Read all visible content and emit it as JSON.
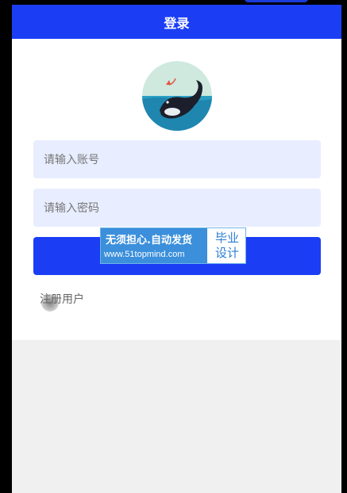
{
  "navbar": {
    "title": "登录"
  },
  "logo": {
    "icon": "whale-logo-icon"
  },
  "form": {
    "username_placeholder": "请输入账号",
    "password_placeholder": "请输入密码",
    "login_label": "",
    "register_label": "注册用户"
  },
  "watermark": {
    "line1": "无须担心.自动发货",
    "line2": "www.51topmind.com",
    "right_line1": "毕业",
    "right_line2": "设计"
  },
  "colors": {
    "primary": "#1b3ef5",
    "input_bg": "#e8edff",
    "page_bg": "#f0f0f0"
  }
}
